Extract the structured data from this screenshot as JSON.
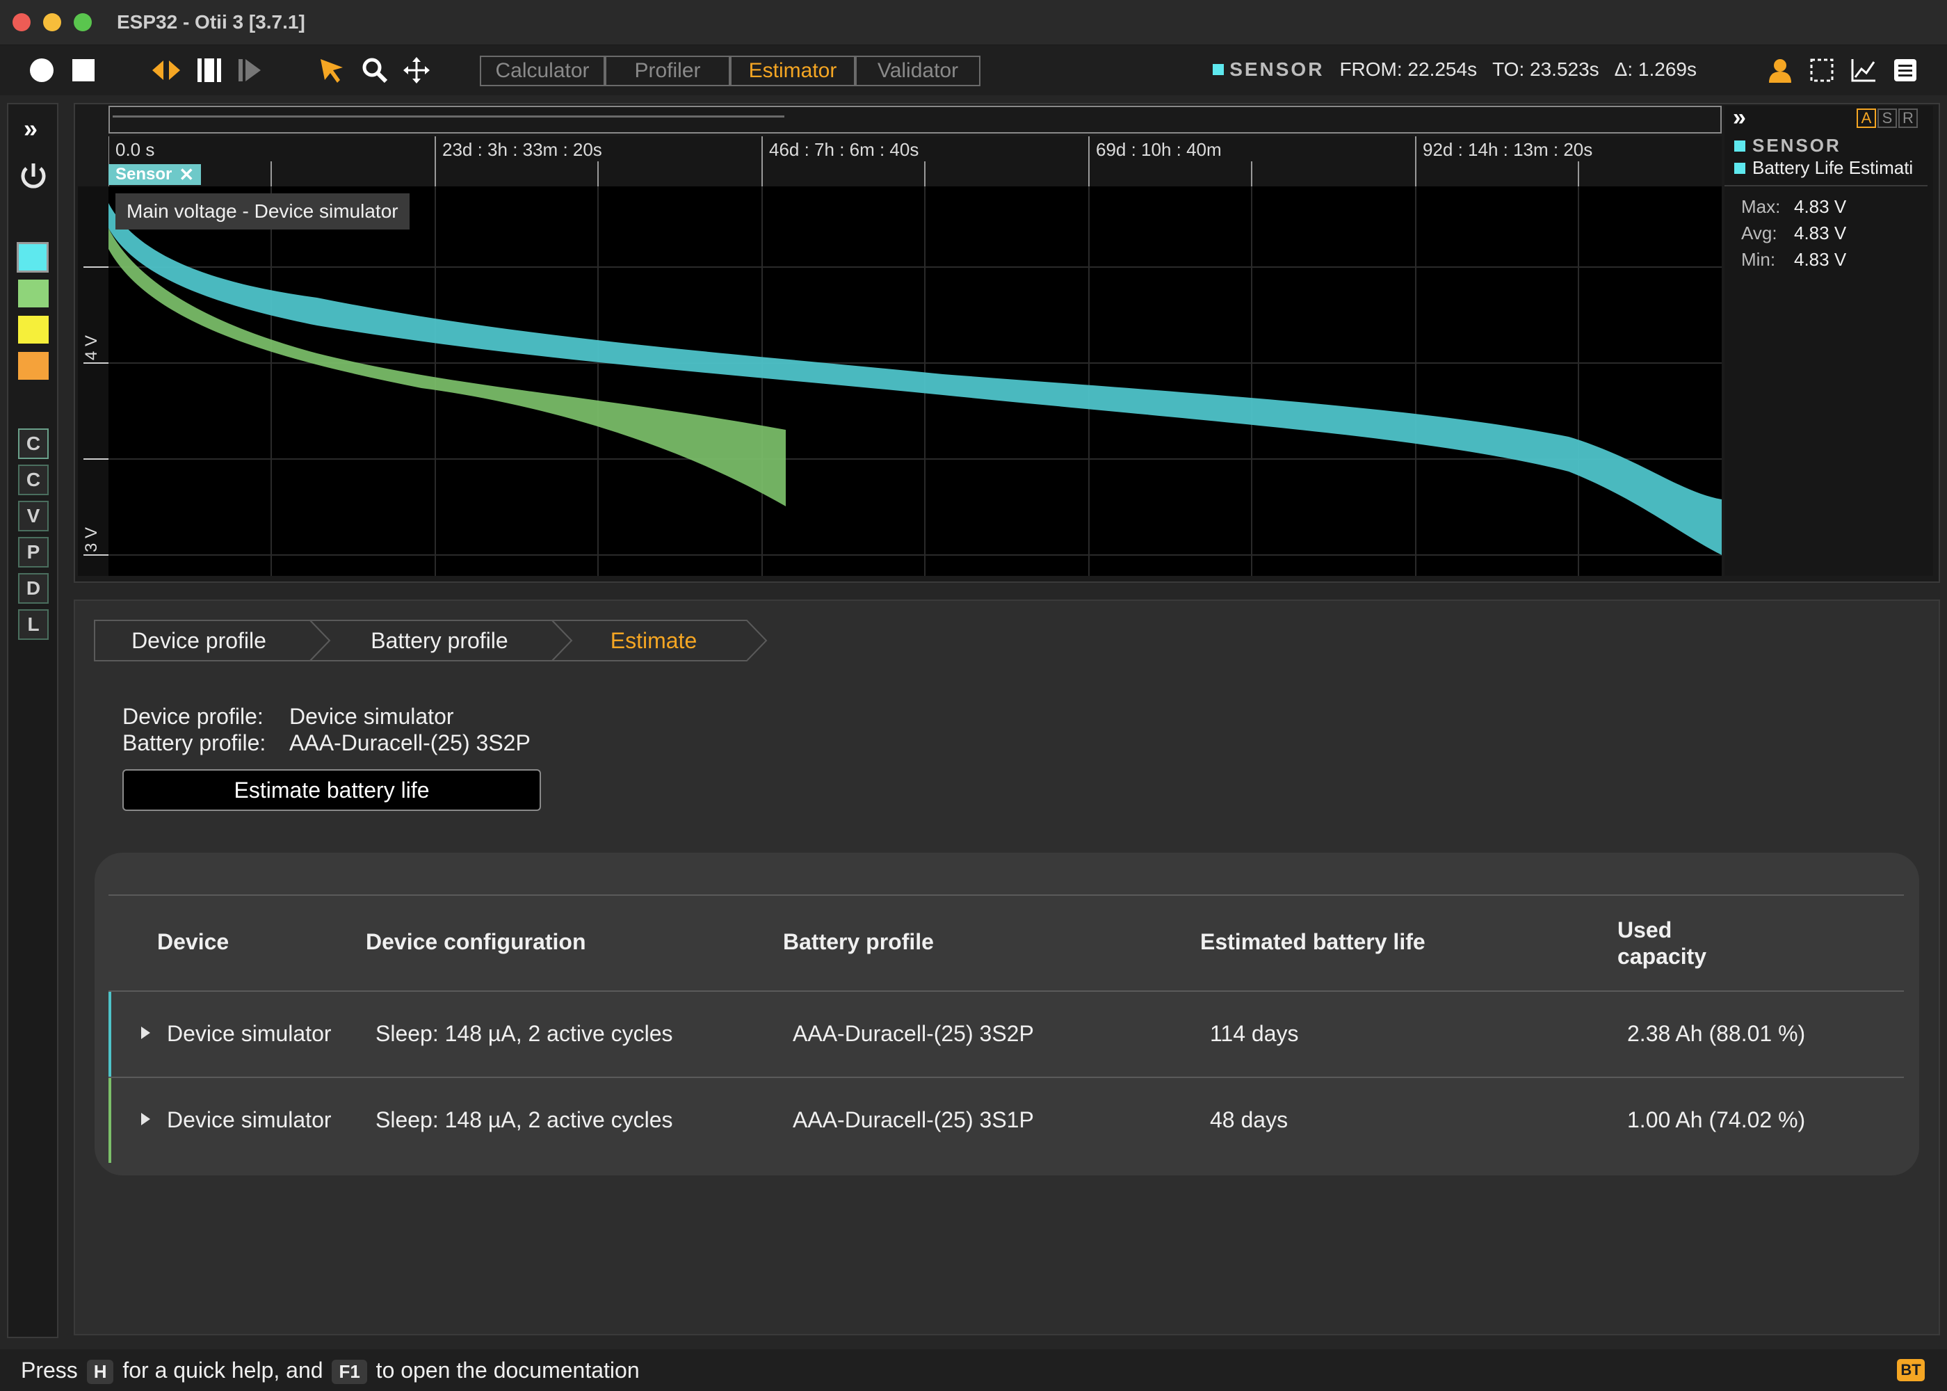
{
  "window": {
    "title": "ESP32 - Otii 3 [3.7.1]"
  },
  "toolbar": {
    "icons": [
      "record-icon",
      "stop-icon",
      "split-arrows-icon",
      "columns-icon",
      "step-forward-icon",
      "cursor-icon",
      "search-icon",
      "move-icon"
    ],
    "modes": [
      {
        "label": "Calculator",
        "active": false
      },
      {
        "label": "Profiler",
        "active": false
      },
      {
        "label": "Estimator",
        "active": true
      },
      {
        "label": "Validator",
        "active": false
      }
    ],
    "status": {
      "sensor_label": "SENSOR",
      "from": "FROM: 22.254s",
      "to": "TO: 23.523s",
      "delta": "Δ: 1.269s"
    },
    "right_icons": [
      "user-icon",
      "selection-icon",
      "chart-icon",
      "menu-icon"
    ]
  },
  "leftrail": {
    "expand": "»",
    "colors": [
      "#5ee8ee",
      "#8fd47a",
      "#f6ef3a",
      "#f5a23a"
    ],
    "letters": [
      "C",
      "C",
      "V",
      "P",
      "D",
      "L"
    ]
  },
  "graph": {
    "timeline_ticks": [
      "0.0 s",
      "23d : 3h : 33m : 20s",
      "46d : 7h : 6m : 40s",
      "69d : 10h : 40m",
      "92d : 14h : 13m : 20s"
    ],
    "y_ticks": [
      "4 V",
      "3 V"
    ],
    "chip": "Sensor",
    "tooltip": "Main voltage - Device simulator",
    "series": [
      {
        "name": "AAA-Duracell-(25) 3S2P",
        "color": "#4ec3c9",
        "days": 114
      },
      {
        "name": "AAA-Duracell-(25) 3S1P",
        "color": "#7cc06a",
        "days": 48
      }
    ]
  },
  "legend": {
    "expand": "»",
    "asr": [
      "A",
      "S",
      "R"
    ],
    "sensor": "SENSOR",
    "series": "Battery Life Estimati",
    "stats": [
      {
        "label": "Max:",
        "value": "4.83 V"
      },
      {
        "label": "Avg:",
        "value": "4.83 V"
      },
      {
        "label": "Min:",
        "value": "4.83 V"
      }
    ]
  },
  "estimator": {
    "breadcrumbs": [
      {
        "label": "Device profile",
        "active": false
      },
      {
        "label": "Battery profile",
        "active": false
      },
      {
        "label": "Estimate",
        "active": true
      }
    ],
    "device_profile_label": "Device profile:",
    "device_profile_value": "Device simulator",
    "battery_profile_label": "Battery profile:",
    "battery_profile_value": "AAA-Duracell-(25) 3S2P",
    "estimate_button": "Estimate battery life",
    "table": {
      "headers": [
        "Device",
        "Device configuration",
        "Battery profile",
        "Estimated battery life",
        "Used capacity"
      ],
      "rows": [
        {
          "device": "Device simulator",
          "config": "Sleep: 148 µA, 2 active cycles",
          "battery": "AAA-Duracell-(25) 3S2P",
          "life": "114 days",
          "capacity": "2.38 Ah (88.01 %)",
          "accent": "#4ec3c9"
        },
        {
          "device": "Device simulator",
          "config": "Sleep: 148 µA, 2 active cycles",
          "battery": "AAA-Duracell-(25) 3S1P",
          "life": "48 days",
          "capacity": "1.00 Ah (74.02 %)",
          "accent": "#7cc06a"
        }
      ]
    }
  },
  "statusbar": {
    "press": "Press",
    "key_h": "H",
    "middle": "for a quick help, and",
    "key_f1": "F1",
    "end": "to open the documentation",
    "badge": "BT"
  }
}
